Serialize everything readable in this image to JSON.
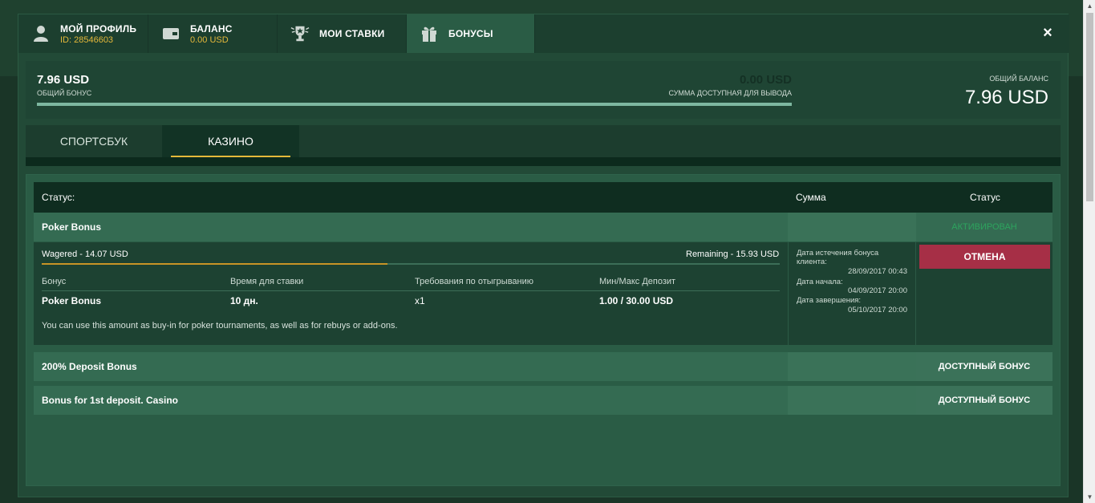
{
  "topnav": {
    "profile": {
      "title": "МОЙ ПРОФИЛЬ",
      "sub": "ID: 28546603"
    },
    "balance": {
      "title": "БАЛАНС",
      "sub": "0.00 USD"
    },
    "bets": {
      "title": "МОИ СТАВКИ"
    },
    "bonuses": {
      "title": "БОНУСЫ"
    },
    "close": "×"
  },
  "balance_bar": {
    "bonus_amount": "7.96 USD",
    "bonus_label": "ОБЩИЙ БОНУС",
    "withdraw_amount": "0.00 USD",
    "withdraw_label": "СУММА ДОСТУПНАЯ ДЛЯ ВЫВОДА",
    "total_label": "ОБЩИЙ БАЛАНС",
    "total_amount": "7.96 USD"
  },
  "subtabs": [
    "СПОРТСБУК",
    "КАЗИНО"
  ],
  "table": {
    "headers": {
      "status": "Статус:",
      "sum": "Сумма",
      "status2": "Статус"
    },
    "rows": [
      {
        "name": "Poker Bonus",
        "status": "АКТИВИРОВАН"
      },
      {
        "name": "200% Deposit Bonus",
        "status": "ДОСТУПНЫЙ БОНУС"
      },
      {
        "name": "Bonus for 1st deposit. Casino",
        "status": "ДОСТУПНЫЙ БОНУС"
      }
    ]
  },
  "detail": {
    "wagered": "Wagered - 14.07 USD",
    "remaining": "Remaining - 15.93 USD",
    "wager_progress": 0.469,
    "columns": [
      "Бонус",
      "Время для ставки",
      "Требования по отыгрыванию",
      "Мин/Макс Депозит"
    ],
    "values": [
      "Poker Bonus",
      "10 дн.",
      "x1",
      "1.00 / 30.00 USD"
    ],
    "description": "You can use this amount as buy-in for poker tournaments, as well as for rebuys or add-ons.",
    "expiry_label_1": "Дата истечения бонуса",
    "expiry_label_2": "клиента:",
    "expiry_value": "28/09/2017 00:43",
    "start_label": "Дата начала:",
    "start_value": "04/09/2017 20:00",
    "end_label": "Дата завершения:",
    "end_value": "05/10/2017 20:00",
    "cancel": "ОТМЕНА"
  },
  "colors": {
    "accent": "#e4b83a",
    "cancel": "#a62f46",
    "activated": "#2da45e"
  }
}
